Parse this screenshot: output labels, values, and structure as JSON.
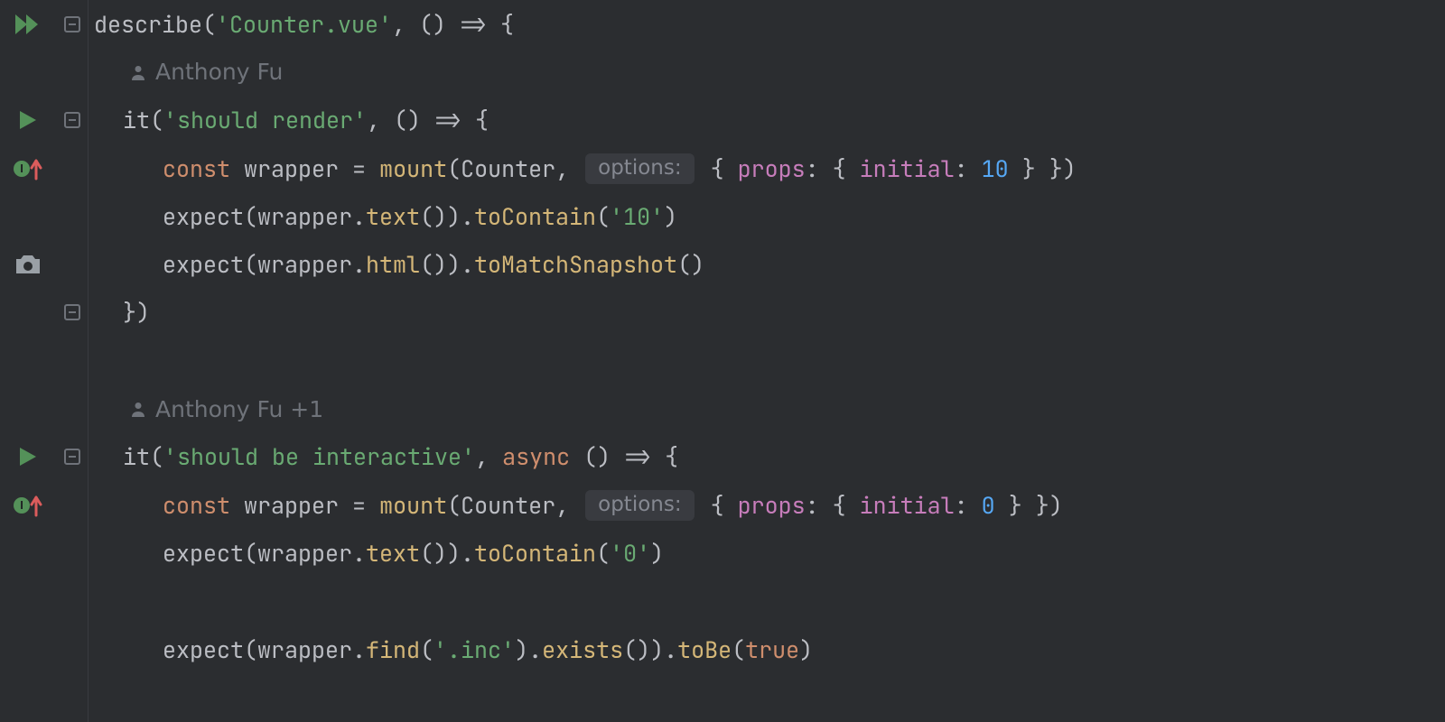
{
  "describe": {
    "fn": "describe",
    "arg": "'Counter.vue'",
    "arrow": ", () => {"
  },
  "vcs1": "Anthony Fu",
  "vcs2": "Anthony Fu +1",
  "it1": {
    "fn": "it",
    "arg": "'should render'",
    "arrow": ", () => {",
    "const": "const",
    "wrapper": "wrapper",
    "eq": " = ",
    "mount": "mount",
    "counter": "Counter",
    "comma": ", ",
    "inlay": "options:",
    "obrace": " { ",
    "props": "props",
    "colon": ": { ",
    "initial": "initial",
    "colon2": ": ",
    "initVal": "10",
    "close": " } })",
    "exp1a": "expect(wrapper.",
    "text": "text",
    "exp1b": "()).",
    "toContain": "toContain",
    "exp1c": "(",
    "v10": "'10'",
    "exp1d": ")",
    "exp2a": "expect(wrapper.",
    "html": "html",
    "exp2b": "()).",
    "snap": "toMatchSnapshot",
    "exp2c": "()",
    "end": "})"
  },
  "it2": {
    "fn": "it",
    "arg": "'should be interactive'",
    "arrowPre": ", ",
    "async": "async",
    "arrowPost": " () => {",
    "const": "const",
    "wrapper": "wrapper",
    "eq": " = ",
    "mount": "mount",
    "counter": "Counter",
    "comma": ", ",
    "inlay": "options:",
    "obrace": " { ",
    "props": "props",
    "colon": ": { ",
    "initial": "initial",
    "colon2": ": ",
    "initVal": "0",
    "close": " } })",
    "exp1a": "expect(wrapper.",
    "text": "text",
    "exp1b": "()).",
    "toContain": "toContain",
    "exp1c": "(",
    "v0": "'0'",
    "exp1d": ")",
    "exp2a": "expect(wrapper.",
    "find": "find",
    "exp2b": "(",
    "inc": "'.inc'",
    "exp2c": ").",
    "exists": "exists",
    "exp2d": "()).",
    "toBe": "toBe",
    "exp2e": "(",
    "true": "true",
    "exp2f": ")"
  }
}
